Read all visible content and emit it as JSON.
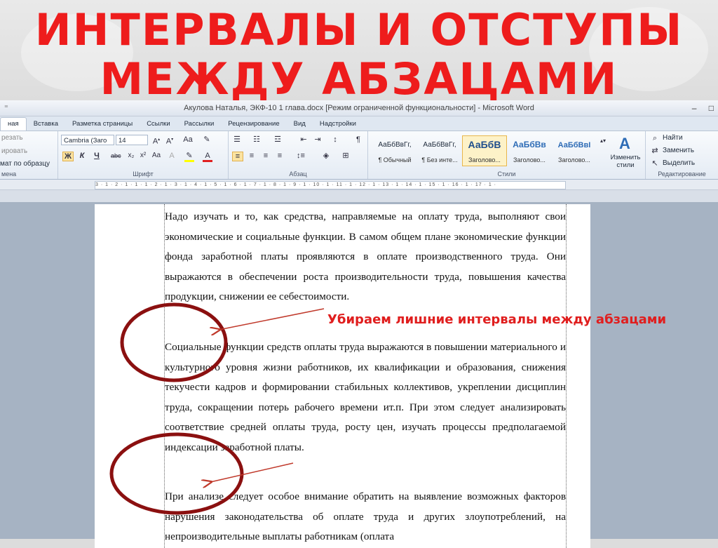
{
  "slide": {
    "title_line1": "ИНТЕРВАЛЫ И ОТСТУПЫ",
    "title_line2": "МЕЖДУ АБЗАЦАМИ",
    "annotation": "Убираем лишние интервалы между абзацами"
  },
  "window": {
    "title": "Акулова Наталья, ЭКФ-10  1 глава.docx [Режим ограниченной функциональности] - Microsoft Word",
    "controls": {
      "minimize": "–",
      "restore": "□"
    }
  },
  "tabs": [
    "ная",
    "Вставка",
    "Разметка страницы",
    "Ссылки",
    "Рассылки",
    "Рецензирование",
    "Вид",
    "Надстройки"
  ],
  "ribbon": {
    "clipboard": {
      "cut": "резать",
      "copy": "ировать",
      "format_painter": "мат по образцу",
      "label": "мена"
    },
    "font": {
      "font_name": "Cambria (Заго",
      "font_size": "14",
      "label": "Шрифт"
    },
    "paragraph": {
      "label": "Абзац"
    },
    "styles": {
      "label": "Стили",
      "items": [
        {
          "preview": "АаБбВвГг,",
          "name": "¶ Обычный"
        },
        {
          "preview": "АаБбВвГг,",
          "name": "¶ Без инте..."
        },
        {
          "preview": "АаБбВ",
          "name": "Заголово..."
        },
        {
          "preview": "АаБбВв",
          "name": "Заголово..."
        },
        {
          "preview": "АаБбВвI",
          "name": "Заголово..."
        }
      ],
      "change_styles": "Изменить стили"
    },
    "editing": {
      "find": "Найти",
      "replace": "Заменить",
      "select": "Выделить",
      "label": "Редактирование"
    }
  },
  "ruler": {
    "ticks": "3 · 1 · 2 · 1 · 1 · 1 · 2 · 1 · 3 · 1 · 4 · 1 · 5 · 1 · 6 · 1 · 7 · 1 · 8 · 1 · 9 · 1 · 10 · 1 · 11 · 1 · 12 · 1 · 13 · 1 · 14 · 1 · 15 · 1 · 16 · 1 · 17 · 1 ·"
  },
  "document": {
    "p1": "Надо изучать и то, как средства, направляемые на оплату труда, выполняют свои экономические и социальные функции. В самом общем плане экономические функции фонда заработной платы проявляются в оплате производственного труда. Они выражаются в обеспечении роста производительности труда, повышения качества продукции, снижении ее себестоимости.",
    "p2": "Социальные функции средств оплаты труда выражаются в повышении материального и культурного уровня жизни работников, их квалификации и образования, снижения текучести кадров и формировании стабильных коллективов, укреплении дисциплин труда, сокращении потерь рабочего времени ит.п. При этом следует анализировать соответствие средней оплаты труда, росту цен, изучать процессы предполагаемой индексации заработной платы.",
    "p3": "При анализе следует особое внимание обратить на выявление возможных факторов нарушения законодательства об оплате труда и других злоупотреблений, на непроизводительные выплаты работникам (оплата"
  },
  "colors": {
    "title": "#ee1c1c",
    "annotation": "#e01e1e",
    "ellipse": "#8b1010",
    "arrow": "#c0392b"
  }
}
